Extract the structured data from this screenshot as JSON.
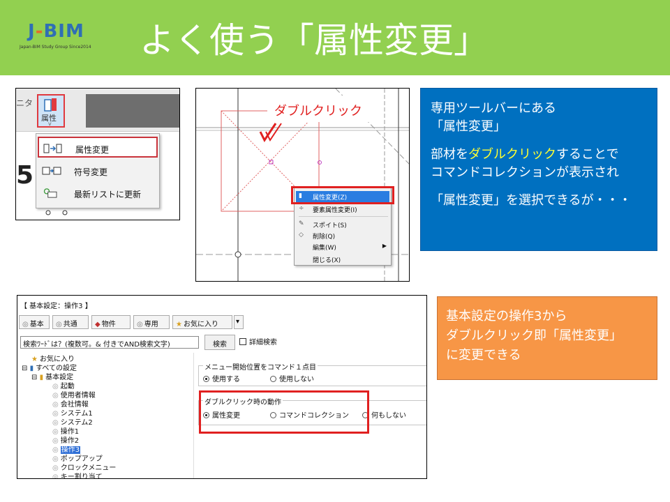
{
  "header": {
    "title": "よく使う「属性変更」",
    "logo_text": "J-BIM",
    "logo_subtitle": "Japan-BIM Study Group Since2014",
    "background": "#92d050"
  },
  "panel1": {
    "ghost_text": "ニタ",
    "button_label": "属性",
    "side_digit": "5",
    "menu": [
      {
        "icon": "attribute-change-icon",
        "label": "属性変更"
      },
      {
        "icon": "code-change-icon",
        "label": "符号変更"
      },
      {
        "icon": "refresh-list-icon",
        "label": "最新リストに更新"
      }
    ]
  },
  "panel2": {
    "callout_label": "ダブルクリック",
    "context_menu": [
      {
        "label": "属性変更(Z)",
        "highlighted": true
      },
      {
        "label": "要素属性変更(I)"
      },
      {
        "label": "スポイト(S)"
      },
      {
        "label": "削除(Q)"
      },
      {
        "label": "編集(W)",
        "submenu": true
      },
      {
        "label": "閉じる(X)"
      }
    ]
  },
  "blue_callout": {
    "line1": "専用ツールバーにある",
    "line2": "「属性変更」",
    "line3_pre": "部材を",
    "line3_highlight": "ダブルクリック",
    "line3_post": "することで",
    "line4": "コマンドコレクションが表示され",
    "line5": "「属性変更」を選択できるが・・・",
    "background": "#0070c0",
    "highlight_color": "#ffff33"
  },
  "panel3": {
    "window_title": "【 基本設定：操作3 】",
    "tabs": [
      "基本",
      "共通",
      "物件",
      "専用",
      "お気に入り"
    ],
    "search_placeholder": "検索ﾜｰﾄﾞは？(複数可。& 付きでAND検索文字)",
    "search_button": "検索",
    "detail_search_label": "詳細検索",
    "tree": [
      {
        "label": "お気に入り"
      },
      {
        "label": "すべての設定",
        "toggle": "⊟"
      },
      {
        "label": "基本設定",
        "toggle": "⊟"
      },
      {
        "label": "起動"
      },
      {
        "label": "使用者情報"
      },
      {
        "label": "会社情報"
      },
      {
        "label": "システム1"
      },
      {
        "label": "システム2"
      },
      {
        "label": "操作1"
      },
      {
        "label": "操作2"
      },
      {
        "label": "操作3",
        "selected": true
      },
      {
        "label": "ポップアップ"
      },
      {
        "label": "クロックメニュー"
      },
      {
        "label": "キー割り当て"
      }
    ],
    "group1": {
      "caption": "メニュー開始位置をコマンド１点目",
      "options": [
        "使用する",
        "使用しない"
      ],
      "selected": 0
    },
    "group2": {
      "caption": "ダブルクリック時の動作",
      "options": [
        "属性変更",
        "コマンドコレクション",
        "何もしない"
      ],
      "selected": 0
    }
  },
  "orange_callout": {
    "line1": "基本設定の操作3から",
    "line2": "ダブルクリック即「属性変更」",
    "line3": "に変更できる",
    "background": "#f79646"
  }
}
